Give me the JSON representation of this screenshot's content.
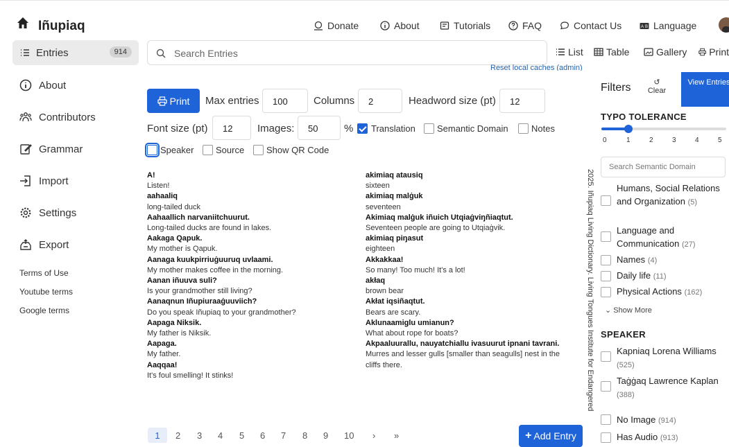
{
  "header": {
    "app_title": "Iñupiaq",
    "nav": [
      {
        "label": "Donate",
        "icon": "donate-icon"
      },
      {
        "label": "About",
        "icon": "info-icon"
      },
      {
        "label": "Tutorials",
        "icon": "tutorial-icon"
      },
      {
        "label": "FAQ",
        "icon": "help-icon"
      },
      {
        "label": "Contact Us",
        "icon": "chat-icon"
      },
      {
        "label": "Language",
        "icon": "language-icon"
      }
    ]
  },
  "sidebar": {
    "entries_label": "Entries",
    "entries_count": "914",
    "items": [
      {
        "label": "About",
        "icon": "info-icon"
      },
      {
        "label": "Contributors",
        "icon": "people-icon"
      },
      {
        "label": "Grammar",
        "icon": "edit-icon"
      },
      {
        "label": "Import",
        "icon": "import-icon"
      },
      {
        "label": "Settings",
        "icon": "gear-icon"
      },
      {
        "label": "Export",
        "icon": "export-icon"
      }
    ],
    "links": [
      "Terms of Use",
      "Youtube terms",
      "Google terms"
    ]
  },
  "search": {
    "placeholder": "Search Entries"
  },
  "views": [
    {
      "label": "List",
      "icon": "list-icon"
    },
    {
      "label": "Table",
      "icon": "table-icon"
    },
    {
      "label": "Gallery",
      "icon": "gallery-icon"
    },
    {
      "label": "Print",
      "icon": "print-icon"
    }
  ],
  "reset_link": "Reset local caches (admin)",
  "print_options": {
    "print_label": "Print",
    "max_entries_label": "Max entries",
    "max_entries": "100",
    "columns_label": "Columns",
    "columns": "2",
    "headword_label": "Headword size (pt)",
    "headword_size": "12",
    "font_size_label": "Font size (pt)",
    "font_size": "12",
    "images_label": "Images:",
    "images": "50",
    "percent": "%",
    "checkboxes": [
      {
        "label": "Translation",
        "checked": true
      },
      {
        "label": "Semantic Domain",
        "checked": false
      },
      {
        "label": "Notes",
        "checked": false
      },
      {
        "label": "Speaker",
        "checked": false
      },
      {
        "label": "Source",
        "checked": false
      },
      {
        "label": "Show QR Code",
        "checked": false
      }
    ]
  },
  "entries_left": [
    {
      "hw": "A!",
      "tr": "Listen!"
    },
    {
      "hw": "aahaaliq",
      "tr": "long-tailed duck"
    },
    {
      "hw": "Aahaallich narvaniitchuurut.",
      "tr": "Long-tailed ducks are found in lakes."
    },
    {
      "hw": "Aakaga Qapuk.",
      "tr": "My mother is Qapuk."
    },
    {
      "hw": "Aanaga kuukpirriuġuuruq uvlaami.",
      "tr": "My mother makes coffee in the morning."
    },
    {
      "hw": "Aanan iñuuva suli?",
      "tr": "Is your grandmother still living?"
    },
    {
      "hw": "Aanaqnun Iñupiuraaġuuviich?",
      "tr": "Do you speak Iñupiaq to your grandmother?"
    },
    {
      "hw": "Aapaga Niksik.",
      "tr": "My father is Niksik."
    },
    {
      "hw": "Aapaga.",
      "tr": "My father."
    },
    {
      "hw": "Aaqqaa!",
      "tr": "It's foul smelling! It stinks!"
    }
  ],
  "entries_right": [
    {
      "hw": "akimiaq atausiq",
      "tr": "sixteen"
    },
    {
      "hw": "akimiaq malġuk",
      "tr": "seventeen"
    },
    {
      "hw": "Akimiaq malġuk iñuich Utqiaġviŋñiaqtut.",
      "tr": "Seventeen people are going to Utqiaġvik."
    },
    {
      "hw": "akimiaq piŋasut",
      "tr": "eighteen"
    },
    {
      "hw": "Akkakkaa!",
      "tr": "So many! Too much! It's a lot!"
    },
    {
      "hw": "akłaq",
      "tr": "brown bear"
    },
    {
      "hw": "Akłat iqsiñaqtut.",
      "tr": "Bears are scary."
    },
    {
      "hw": "Aklunaamiglu umianun?",
      "tr": "What about rope for boats?"
    },
    {
      "hw": "Akpaaluurallu, nauyatchiallu ivasuurut ipnani tavrani.",
      "tr": "Murres and lesser gulls [smaller than seagulls] nest in the cliffs there."
    }
  ],
  "vertical_citation": "2025. Iñupiaq Living Dictionary. Living Tongues Institute for Endangered",
  "pagination": [
    "1",
    "2",
    "3",
    "4",
    "5",
    "6",
    "7",
    "8",
    "9",
    "10"
  ],
  "pagination_current": "1",
  "add_entry": "Add Entry",
  "filters": {
    "title": "Filters",
    "clear": "Clear",
    "view_entries": "View Entries",
    "typo_title": "TYPO TOLERANCE",
    "typo_value": 1,
    "typo_ticks": [
      "0",
      "1",
      "2",
      "3",
      "4",
      "5"
    ],
    "sem_placeholder": "Search Semantic Domain",
    "domains": [
      {
        "label": "Humans, Social Relations and Organization",
        "count": "(5)"
      },
      {
        "label": "Language and Communication",
        "count": "(27)"
      },
      {
        "label": "Names",
        "count": "(4)"
      },
      {
        "label": "Daily life",
        "count": "(11)"
      },
      {
        "label": "Physical Actions",
        "count": "(162)"
      }
    ],
    "show_more": "Show More",
    "speaker_title": "SPEAKER",
    "speakers": [
      {
        "label": "Kapniaq Lorena Williams",
        "count": "(525)"
      },
      {
        "label": "Taġġaq Lawrence Kaplan",
        "count": "(388)"
      }
    ],
    "media": [
      {
        "label": "No Image",
        "count": "(914)"
      },
      {
        "label": "Has Audio",
        "count": "(913)"
      }
    ]
  },
  "colors": {
    "accent": "#1e63d8"
  }
}
